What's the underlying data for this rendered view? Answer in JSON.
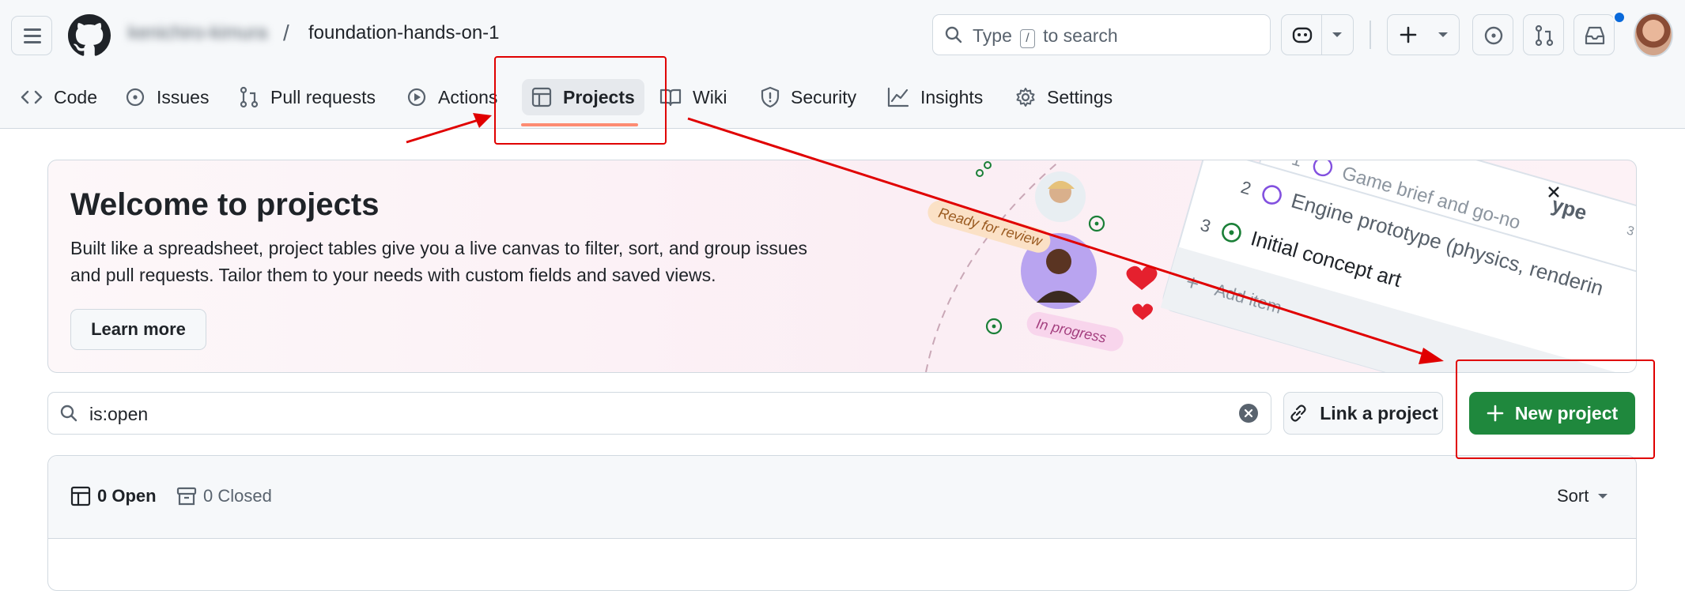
{
  "header": {
    "owner": "kenichiro-kimura",
    "separator": "/",
    "repo": "foundation-hands-on-1",
    "search": {
      "prefix": "Type",
      "key": "/",
      "suffix": "to search"
    }
  },
  "tabs": [
    {
      "label": "Code",
      "icon": "code-icon"
    },
    {
      "label": "Issues",
      "icon": "issue-icon"
    },
    {
      "label": "Pull requests",
      "icon": "pull-request-icon"
    },
    {
      "label": "Actions",
      "icon": "play-icon"
    },
    {
      "label": "Projects",
      "icon": "table-icon",
      "active": true
    },
    {
      "label": "Wiki",
      "icon": "book-icon"
    },
    {
      "label": "Security",
      "icon": "shield-icon"
    },
    {
      "label": "Insights",
      "icon": "graph-icon"
    },
    {
      "label": "Settings",
      "icon": "gear-icon"
    }
  ],
  "banner": {
    "title": "Welcome to projects",
    "description_line1": "Built like a spreadsheet, project tables give you a live canvas to filter, sort, and group issues",
    "description_line2": "and pull requests. Tailor them to your needs with custom fields and saved views.",
    "learn_more": "Learn more",
    "illustration": {
      "ready_label": "Ready for review",
      "progress_label": "In progress",
      "row1_num": "1",
      "row1_text": "Game brief and go-no",
      "row2_num": "2",
      "row2_text": "Engine prototype (physics, renderin",
      "row3_num": "3",
      "row3_text": "Initial concept art",
      "add_item": "Add item",
      "top_word": "ype",
      "badge": "3"
    }
  },
  "filter": {
    "value": "is:open"
  },
  "actions": {
    "link_project": "Link a project",
    "new_project": "New project"
  },
  "list": {
    "open_label": "0 Open",
    "closed_label": "0 Closed",
    "sort_label": "Sort"
  },
  "colors": {
    "accent_green": "#1f883d",
    "tab_underline": "#fd8c73",
    "annotation_red": "#e00000"
  }
}
